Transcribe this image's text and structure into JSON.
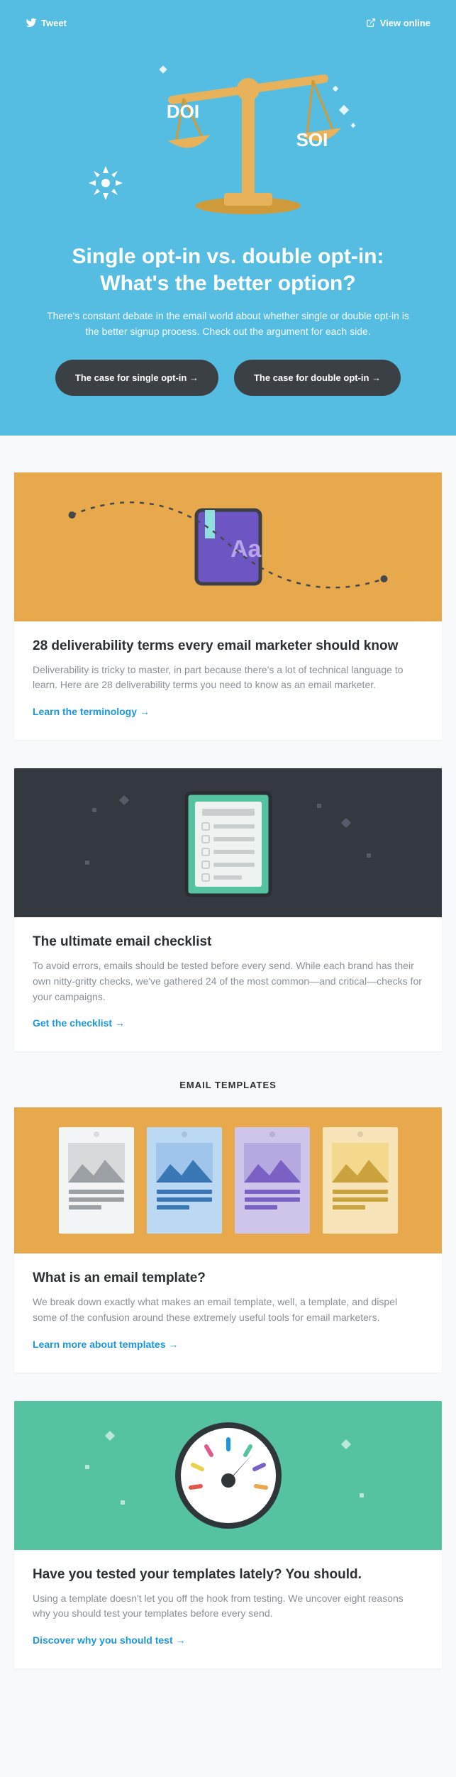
{
  "top": {
    "tweet": "Tweet",
    "view_online": "View online"
  },
  "hero": {
    "badge_left": "DOI",
    "badge_right": "SOI",
    "title": "Single opt-in vs. double opt-in: What's the better option?",
    "sub": "There's constant debate in the email world about whether single or double opt-in is the better signup process. Check out the argument for each side.",
    "btn_single": "The case for single opt-in →",
    "btn_double": "The case for double opt-in →"
  },
  "card1": {
    "title": "28 deliverability terms every email marketer should know",
    "body": "Deliverability is tricky to master, in part because there's a lot of technical language to learn. Here are 28 deliverability terms you need to know as an email marketer.",
    "cta": "Learn the terminology →"
  },
  "card2": {
    "title": "The ultimate email checklist",
    "body": "To avoid errors, emails should be tested before every send. While each brand has their own nitty-gritty checks, we've gathered 24 of the most common—and critical—checks for your campaigns.",
    "cta": "Get the checklist →"
  },
  "section_templates": "EMAIL TEMPLATES",
  "card3": {
    "title": "What is an email template?",
    "body": "We break down exactly what makes an email template, well, a template, and dispel some of the confusion around these extremely useful tools for email marketers.",
    "cta": "Learn more about templates →"
  },
  "card4": {
    "title": "Have you tested your templates lately? You should.",
    "body": "Using a template doesn't let you off the hook from testing. We uncover eight reasons why you should test your templates before every send.",
    "cta": "Discover why you should test →"
  }
}
